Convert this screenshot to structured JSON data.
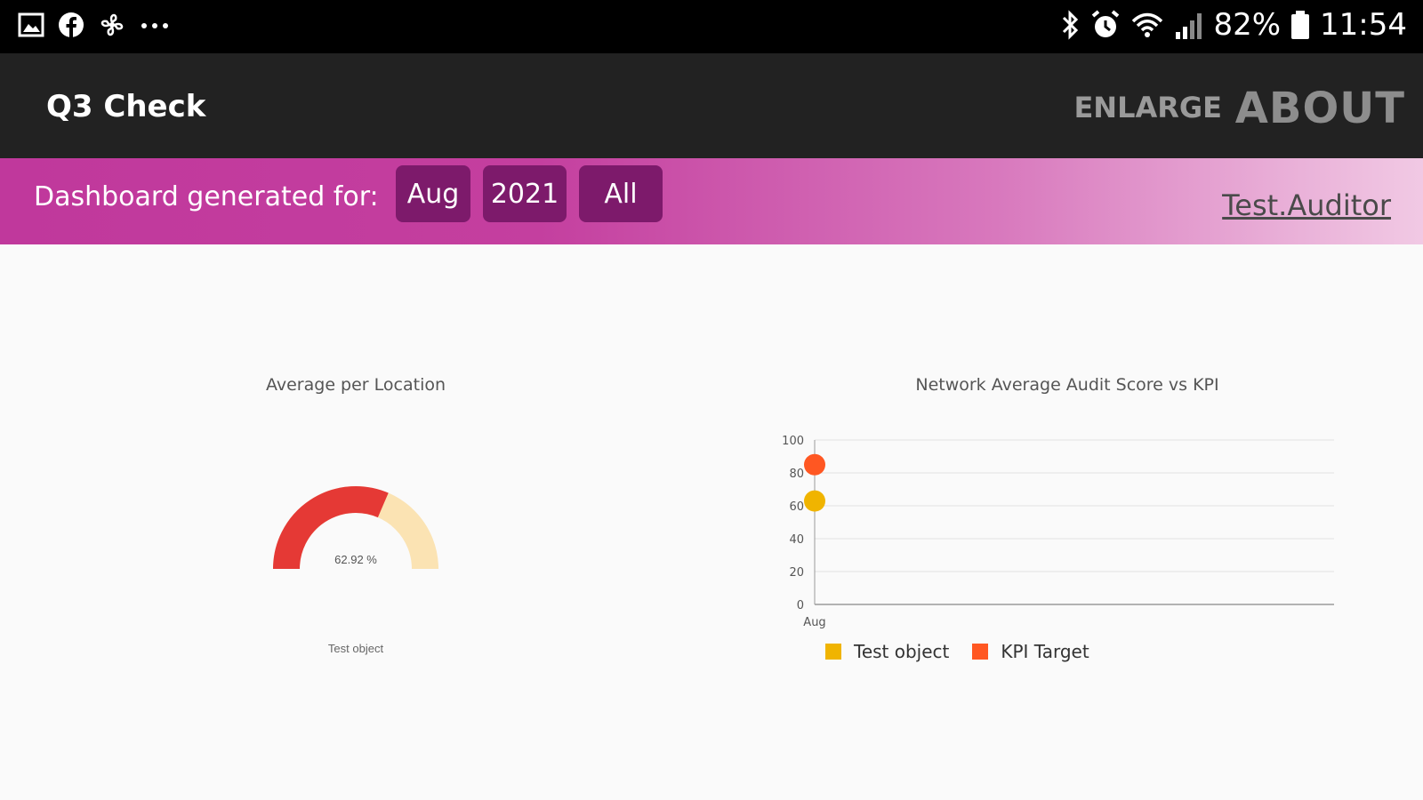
{
  "status_bar": {
    "icons_left": [
      "image-icon",
      "facebook-icon",
      "fan-icon",
      "more-icon"
    ],
    "icons_right": [
      "bluetooth-icon",
      "alarm-icon",
      "wifi-icon",
      "signal-icon",
      "battery-icon"
    ],
    "battery": "82%",
    "time": "11:54"
  },
  "app_bar": {
    "title": "Q3 Check",
    "enlarge_label": "ENLARGE",
    "about_label": "ABOUT"
  },
  "filter_bar": {
    "label": "Dashboard generated for:",
    "month": "Aug",
    "year": "2021",
    "scope": "All",
    "user": "Test.Auditor"
  },
  "gauge": {
    "title": "Average per Location",
    "value_text": "62.92 %",
    "value": 62.92,
    "label": "Test object",
    "fill_color": "#e53935",
    "track_color": "#fbe3b3"
  },
  "chart_data": {
    "type": "scatter",
    "title": "Network Average Audit Score vs KPI",
    "categories": [
      "Aug"
    ],
    "ylim": [
      0,
      100
    ],
    "yticks": [
      0,
      20,
      40,
      60,
      80,
      100
    ],
    "grid": true,
    "legend_position": "bottom-left",
    "series": [
      {
        "name": "Test object",
        "values": [
          62.92
        ],
        "color": "#f0b400"
      },
      {
        "name": "KPI Target",
        "values": [
          85
        ],
        "color": "#ff5722"
      }
    ]
  }
}
